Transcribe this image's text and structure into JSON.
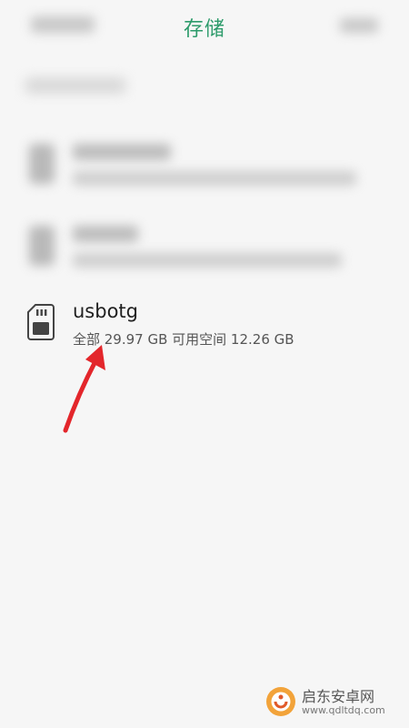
{
  "header": {
    "title": "存储"
  },
  "storage": {
    "usb_item": {
      "name": "usbotg",
      "detail": "全部 29.97 GB 可用空间 12.26 GB"
    }
  },
  "watermark": {
    "name": "启东安卓网",
    "url": "www.qdltdq.com"
  },
  "colors": {
    "title_green": "#2d9b6b",
    "annotation_red": "#e3262b"
  },
  "icons": {
    "usb_item": "sd-card-icon",
    "annotation": "red-arrow-icon",
    "watermark": "watermark-logo-icon"
  }
}
